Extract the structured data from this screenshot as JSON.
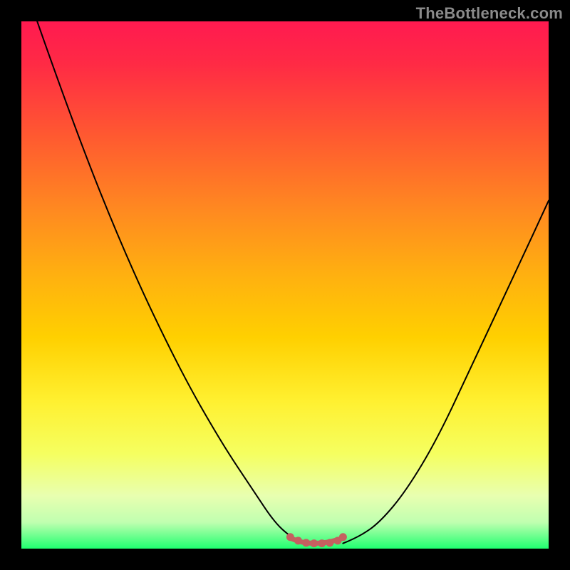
{
  "watermark": "TheBottleneck.com",
  "chart_data": {
    "type": "line",
    "title": "",
    "xlabel": "",
    "ylabel": "",
    "xlim": [
      0,
      100
    ],
    "ylim": [
      0,
      100
    ],
    "grid": false,
    "series": [
      {
        "name": "left-descending-curve",
        "color": "#000000",
        "x": [
          3,
          10,
          20,
          30,
          38,
          44,
          48,
          51,
          53,
          54.5
        ],
        "y": [
          100,
          80,
          55,
          34,
          20,
          11,
          5,
          2.3,
          1.3,
          1
        ]
      },
      {
        "name": "right-ascending-curve",
        "color": "#000000",
        "x": [
          61,
          64,
          68,
          73,
          79,
          86,
          94,
          100
        ],
        "y": [
          1,
          2.2,
          5,
          11,
          21,
          36,
          53,
          66
        ]
      },
      {
        "name": "bottom-flat-segment",
        "color": "#c56060",
        "x": [
          51,
          53,
          55,
          58,
          61
        ],
        "y": [
          2.0,
          1.2,
          1.0,
          1.1,
          2.0
        ]
      }
    ],
    "markers": [
      {
        "x": 51.0,
        "y": 2.2,
        "color": "#c56060"
      },
      {
        "x": 52.5,
        "y": 1.5,
        "color": "#c56060"
      },
      {
        "x": 54.0,
        "y": 1.1,
        "color": "#c56060"
      },
      {
        "x": 55.5,
        "y": 1.0,
        "color": "#c56060"
      },
      {
        "x": 57.0,
        "y": 1.0,
        "color": "#c56060"
      },
      {
        "x": 58.5,
        "y": 1.1,
        "color": "#c56060"
      },
      {
        "x": 60.0,
        "y": 1.5,
        "color": "#c56060"
      },
      {
        "x": 61.0,
        "y": 2.2,
        "color": "#c56060"
      }
    ]
  }
}
